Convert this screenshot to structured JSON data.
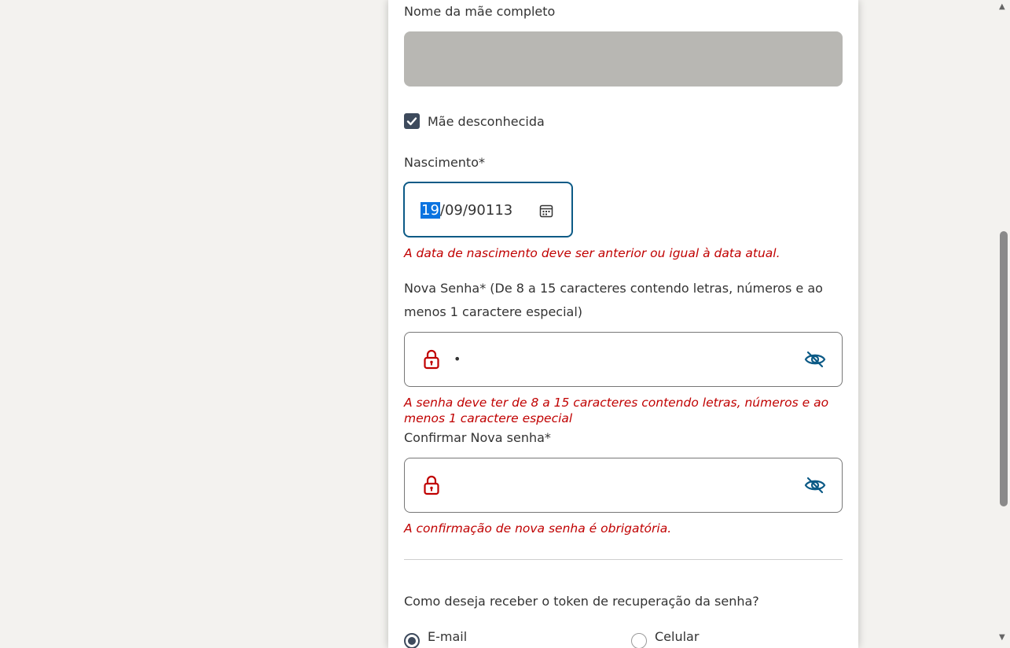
{
  "mother_name": {
    "label": "Nome da mãe completo",
    "value": ""
  },
  "mother_unknown": {
    "label": "Mãe desconhecida",
    "checked": true
  },
  "birth": {
    "label": "Nascimento*",
    "day": "19",
    "sep1": "/",
    "month": "09",
    "sep2": "/",
    "year": "90113",
    "error": "A data de nascimento deve ser anterior ou igual à data atual."
  },
  "new_password": {
    "label_line1": "Nova Senha* (De 8 a 15 caracteres contendo letras, números e ao",
    "label_line2": "menos 1 caractere especial)",
    "value_masked": "•",
    "error_line1": "A senha deve ter de 8 a 15 caracteres contendo letras, números e ao",
    "error_line2": "menos 1 caractere especial"
  },
  "confirm_password": {
    "label": "Confirmar Nova senha*",
    "value_masked": "",
    "error": "A confirmação de nova senha é obrigatória."
  },
  "token": {
    "question": "Como deseja receber o token de recuperação da senha?",
    "options": [
      {
        "label": "E-mail",
        "selected": true
      },
      {
        "label": "Celular",
        "selected": false
      }
    ]
  },
  "colors": {
    "error": "#c00000",
    "focus_border": "#0c5a86",
    "checkbox": "#3d4a5c",
    "disabled_field": "#b8b7b3",
    "icon_lock": "#c00000",
    "icon_eye": "#0c5a86"
  },
  "icons": {
    "calendar": "calendar-icon",
    "lock": "lock-icon",
    "eye": "eye-slash-icon",
    "check": "check-icon"
  }
}
